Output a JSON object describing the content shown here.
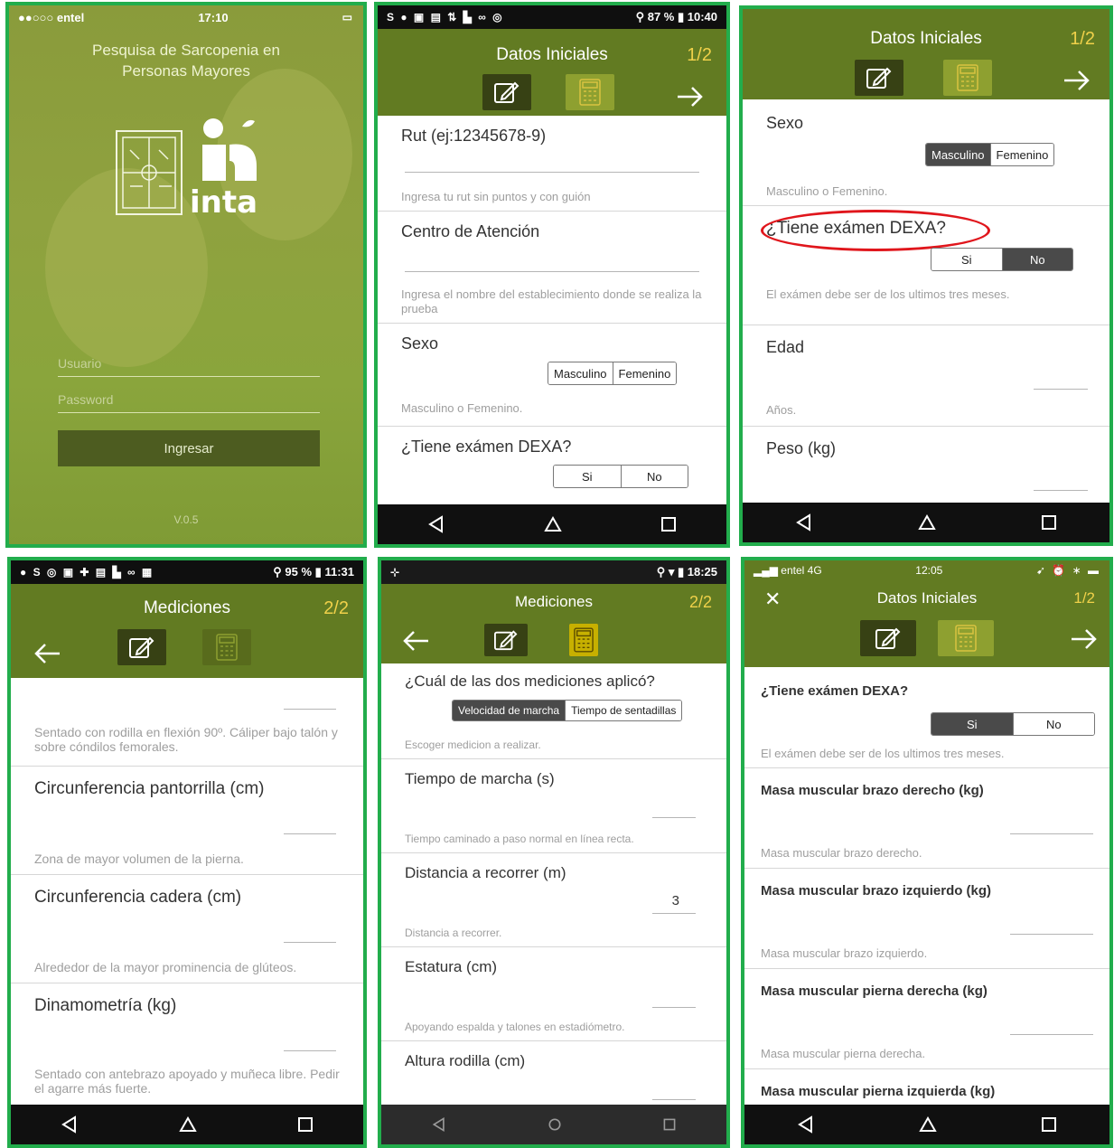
{
  "login": {
    "status": {
      "carrier": "entel",
      "time": "17:10"
    },
    "title_line1": "Pesquisa de Sarcopenia en",
    "title_line2": "Personas Mayores",
    "logo_text": "inta",
    "username_placeholder": "Usuario",
    "password_placeholder": "Password",
    "login_button": "Ingresar",
    "version": "V.0.5"
  },
  "screen2": {
    "status": {
      "battery": "87 %",
      "time": "10:40"
    },
    "title": "Datos Iniciales",
    "page": "1/2",
    "fields": [
      {
        "label": "Rut (ej:12345678-9)",
        "hint": "Ingresa tu rut sin puntos y con guión"
      },
      {
        "label": "Centro de Atención",
        "hint": "Ingresa el nombre del establecimiento donde se realiza la prueba"
      },
      {
        "label": "Sexo",
        "hint": "Masculino o Femenino.",
        "options": [
          "Masculino",
          "Femenino"
        ]
      },
      {
        "label": "¿Tiene exámen DEXA?",
        "options": [
          "Si",
          "No"
        ]
      }
    ]
  },
  "screen3": {
    "title": "Datos Iniciales",
    "page": "1/2",
    "fields": [
      {
        "label": "Sexo",
        "hint": "Masculino o Femenino.",
        "options": [
          "Masculino",
          "Femenino"
        ],
        "selected": "Masculino"
      },
      {
        "label": "¿Tiene exámen DEXA?",
        "hint": "El exámen debe ser de los ultimos tres meses.",
        "options": [
          "Si",
          "No"
        ],
        "selected": "No"
      },
      {
        "label": "Edad",
        "hint": "Años."
      },
      {
        "label": "Peso (kg)"
      }
    ],
    "highlight_color": "#e0161c"
  },
  "screen4": {
    "status": {
      "battery": "95 %",
      "time": "11:31"
    },
    "title": "Mediciones",
    "page": "2/2",
    "top_hint": "Sentado con rodilla en flexión 90º. Cáliper bajo talón y sobre cóndilos femorales.",
    "fields": [
      {
        "label": "Circunferencia pantorrilla (cm)",
        "hint": "Zona de mayor volumen de la pierna."
      },
      {
        "label": "Circunferencia cadera (cm)",
        "hint": "Alrededor de la mayor prominencia de glúteos."
      },
      {
        "label": "Dinamometría (kg)",
        "hint": "Sentado con antebrazo apoyado y muñeca libre. Pedir el agarre más fuerte."
      }
    ]
  },
  "screen5": {
    "status": {
      "time": "18:25"
    },
    "title": "Mediciones",
    "page": "2/2",
    "fields": [
      {
        "label": "¿Cuál de las dos mediciones aplicó?",
        "hint": "Escoger medicion a realizar.",
        "options": [
          "Velocidad de marcha",
          "Tiempo de sentadillas"
        ],
        "selected": "Velocidad de marcha"
      },
      {
        "label": "Tiempo de marcha (s)",
        "hint": "Tiempo caminado a paso normal en línea recta."
      },
      {
        "label": "Distancia a recorrer (m)",
        "hint": "Distancia a recorrer.",
        "value": "3"
      },
      {
        "label": "Estatura (cm)",
        "hint": "Apoyando espalda y talones en estadiómetro."
      },
      {
        "label": "Altura rodilla (cm)"
      }
    ]
  },
  "screen6": {
    "status": {
      "carrier": "entel",
      "network": "4G",
      "time": "12:05"
    },
    "title": "Datos Iniciales",
    "page": "1/2",
    "fields": [
      {
        "label": "¿Tiene exámen DEXA?",
        "hint": "El exámen debe ser de los ultimos tres meses.",
        "options": [
          "Si",
          "No"
        ],
        "selected": "Si"
      },
      {
        "label": "Masa muscular brazo derecho (kg)",
        "hint": "Masa muscular brazo derecho."
      },
      {
        "label": "Masa muscular brazo izquierdo (kg)",
        "hint": "Masa muscular brazo izquierdo."
      },
      {
        "label": "Masa muscular pierna derecha (kg)",
        "hint": "Masa muscular pierna derecha."
      },
      {
        "label": "Masa muscular pierna izquierda (kg)"
      }
    ]
  },
  "icons": {
    "edit": "pencil-icon",
    "calc": "calculator-icon",
    "next": "arrow-right-icon",
    "back": "arrow-left-icon",
    "nav_back": "triangle-back-icon",
    "nav_home": "home-icon",
    "nav_recent": "square-recent-icon"
  },
  "colors": {
    "header": "#627b22",
    "border": "#22ad4c",
    "page_number": "#f0d14a"
  }
}
